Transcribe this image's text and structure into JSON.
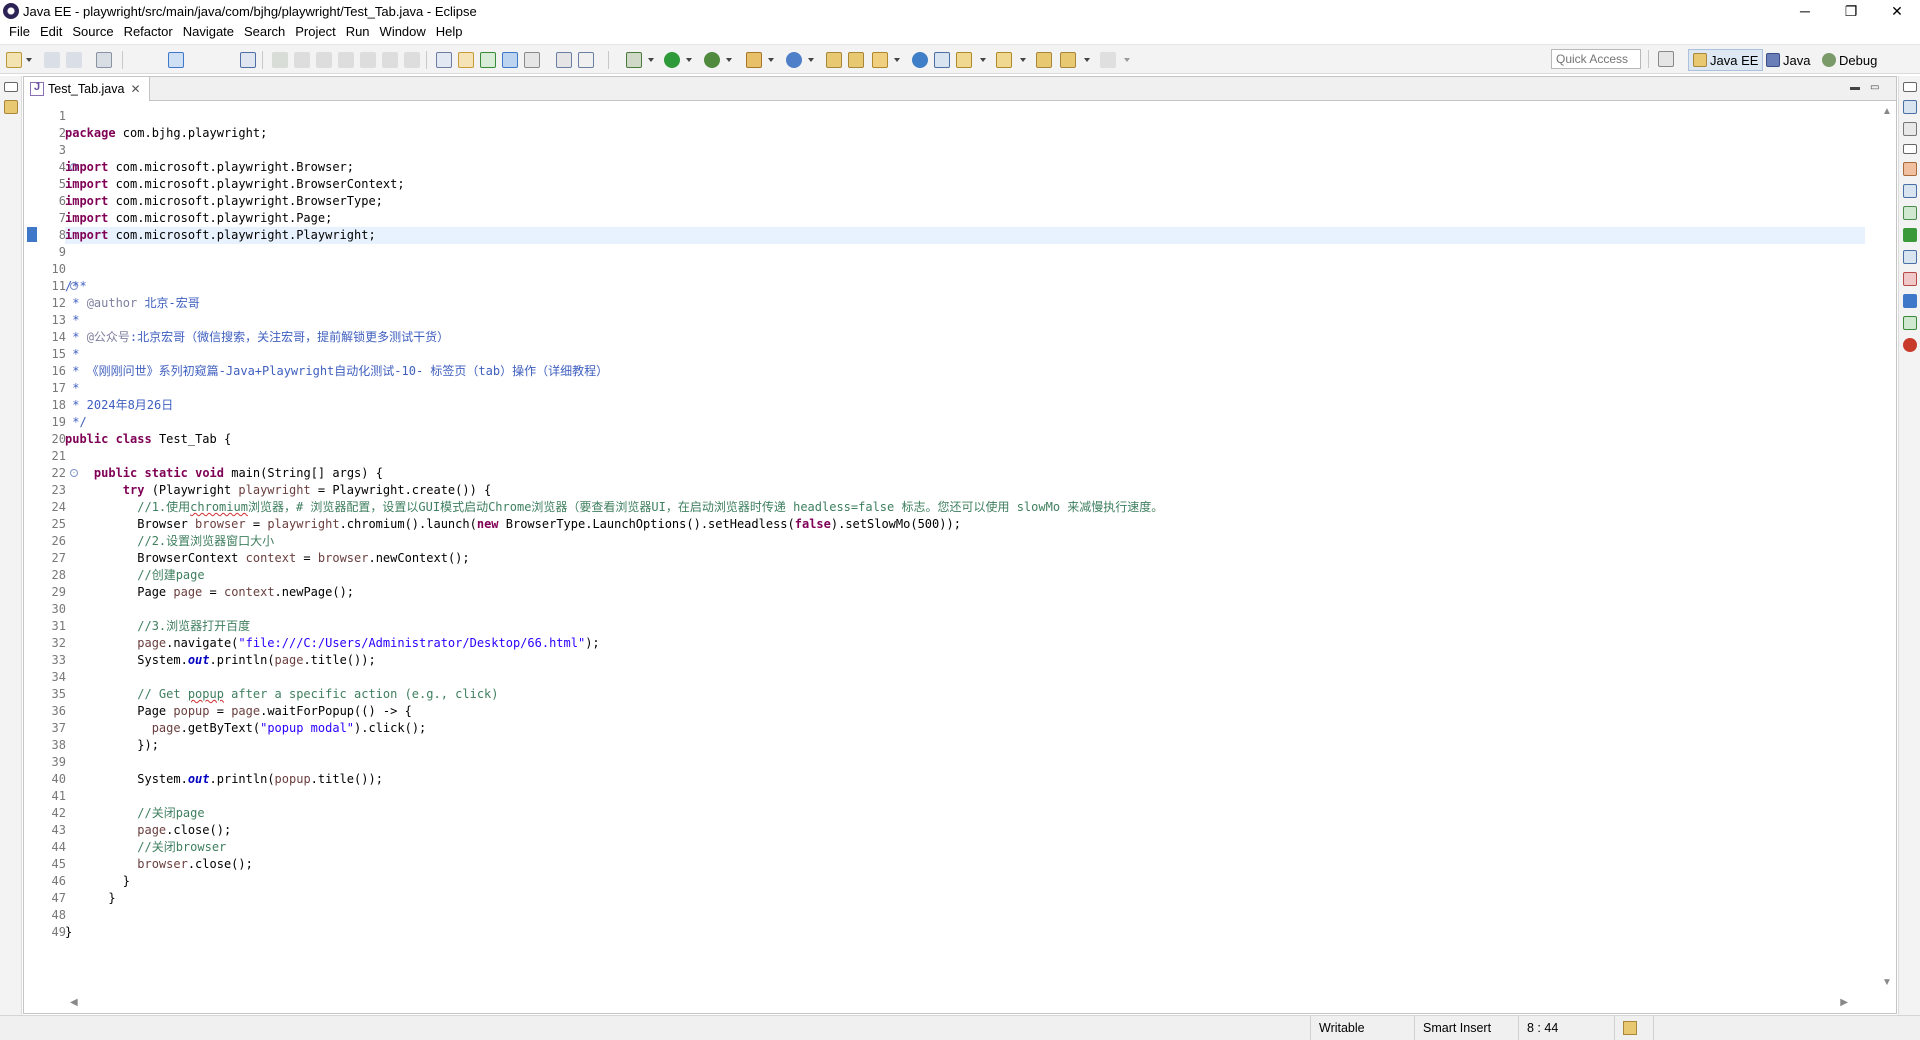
{
  "window": {
    "title": "Java EE - playwright/src/main/java/com/bjhg/playwright/Test_Tab.java - Eclipse",
    "controls": {
      "minimize": "─",
      "maximize": "❐",
      "close": "✕"
    }
  },
  "menu": [
    "File",
    "Edit",
    "Source",
    "Refactor",
    "Navigate",
    "Search",
    "Project",
    "Run",
    "Window",
    "Help"
  ],
  "toolbar": {
    "quick_access_placeholder": "Quick Access",
    "perspectives": [
      {
        "label": "Java EE",
        "active": true
      },
      {
        "label": "Java",
        "active": false
      },
      {
        "label": "Debug",
        "active": false
      }
    ]
  },
  "editor": {
    "tab_label": "Test_Tab.java",
    "tab_close": "✕",
    "current_line": 8,
    "lines": [
      "",
      "package com.bjhg.playwright;",
      "",
      "import com.microsoft.playwright.Browser;",
      "import com.microsoft.playwright.BrowserContext;",
      "import com.microsoft.playwright.BrowserType;",
      "import com.microsoft.playwright.Page;",
      "import com.microsoft.playwright.Playwright;",
      "",
      "",
      "/**",
      " * @author 北京-宏哥",
      " *",
      " * @公众号:北京宏哥（微信搜索，关注宏哥，提前解锁更多测试干货）",
      " *",
      " * 《刚刚问世》系列初窥篇-Java+Playwright自动化测试-10- 标签页（tab）操作（详细教程）",
      " *",
      " * 2024年8月26日",
      " */",
      "public class Test_Tab {",
      "",
      "    public static void main(String[] args) {",
      "        try (Playwright playwright = Playwright.create()) {",
      "          //1.使用chromium浏览器，# 浏览器配置，设置以GUI模式启动Chrome浏览器（要查看浏览器UI，在启动浏览器时传递 headless=false 标志。您还可以使用 slowMo 来减慢执行速度。",
      "          Browser browser = playwright.chromium().launch(new BrowserType.LaunchOptions().setHeadless(false).setSlowMo(500));",
      "          //2.设置浏览器窗口大小",
      "          BrowserContext context = browser.newContext();",
      "          //创建page",
      "          Page page = context.newPage();",
      "",
      "          //3.浏览器打开百度",
      "          page.navigate(\"file:///C:/Users/Administrator/Desktop/66.html\");",
      "          System.out.println(page.title());",
      "",
      "          // Get popup after a specific action (e.g., click)",
      "          Page popup = page.waitForPopup(() -> {",
      "            page.getByText(\"popup modal\").click();",
      "          });",
      "",
      "          System.out.println(popup.title());",
      "",
      "          //关闭page",
      "          page.close();",
      "          //关闭browser",
      "          browser.close();",
      "        }",
      "      }",
      "",
      "}"
    ]
  },
  "status": {
    "writable": "Writable",
    "insert_mode": "Smart Insert",
    "position": "8 : 44"
  }
}
